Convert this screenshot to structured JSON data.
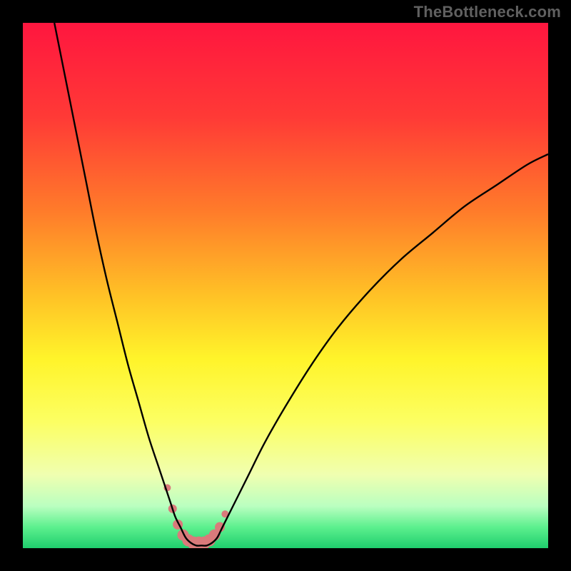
{
  "watermark": {
    "text": "TheBottleneck.com"
  },
  "gradient": {
    "stops": [
      {
        "offset": 0.0,
        "color": "#ff163f"
      },
      {
        "offset": 0.18,
        "color": "#ff3a36"
      },
      {
        "offset": 0.36,
        "color": "#ff7c2a"
      },
      {
        "offset": 0.52,
        "color": "#ffc226"
      },
      {
        "offset": 0.64,
        "color": "#fff42a"
      },
      {
        "offset": 0.76,
        "color": "#fcff63"
      },
      {
        "offset": 0.86,
        "color": "#f0ffb0"
      },
      {
        "offset": 0.92,
        "color": "#baffc0"
      },
      {
        "offset": 0.96,
        "color": "#5cf08e"
      },
      {
        "offset": 1.0,
        "color": "#1fce6d"
      }
    ]
  },
  "chart_data": {
    "type": "line",
    "title": "",
    "xlabel": "",
    "ylabel": "",
    "xlim": [
      0,
      100
    ],
    "ylim": [
      0,
      100
    ],
    "series": [
      {
        "name": "bottleneck-curve",
        "x": [
          6,
          8,
          10,
          12,
          14,
          16,
          18,
          20,
          22,
          24,
          26,
          28,
          29,
          30,
          31,
          32,
          33,
          34,
          35,
          36,
          37,
          38,
          40,
          43,
          46,
          50,
          55,
          60,
          66,
          72,
          78,
          84,
          90,
          96,
          100
        ],
        "values": [
          100,
          90,
          80,
          70,
          60,
          51,
          43,
          35,
          28,
          21,
          15,
          9,
          6,
          4,
          2,
          1,
          0.5,
          0.5,
          0.5,
          1,
          2,
          4,
          8,
          14,
          20,
          27,
          35,
          42,
          49,
          55,
          60,
          65,
          69,
          73,
          75
        ]
      }
    ],
    "markers": {
      "name": "highlight-band",
      "color": "#d97a7b",
      "x": [
        27.5,
        28.5,
        29.5,
        30.5,
        31.5,
        32.5,
        33.5,
        34.5,
        35.5,
        36.5,
        37.5,
        38.5
      ],
      "values": [
        11.5,
        7.5,
        4.5,
        2.5,
        1.5,
        1.0,
        1.0,
        1.0,
        1.5,
        2.5,
        4.0,
        6.5
      ],
      "radii": [
        5,
        6,
        7,
        8,
        8.5,
        9,
        9,
        9,
        8.5,
        8,
        7,
        5
      ]
    }
  }
}
